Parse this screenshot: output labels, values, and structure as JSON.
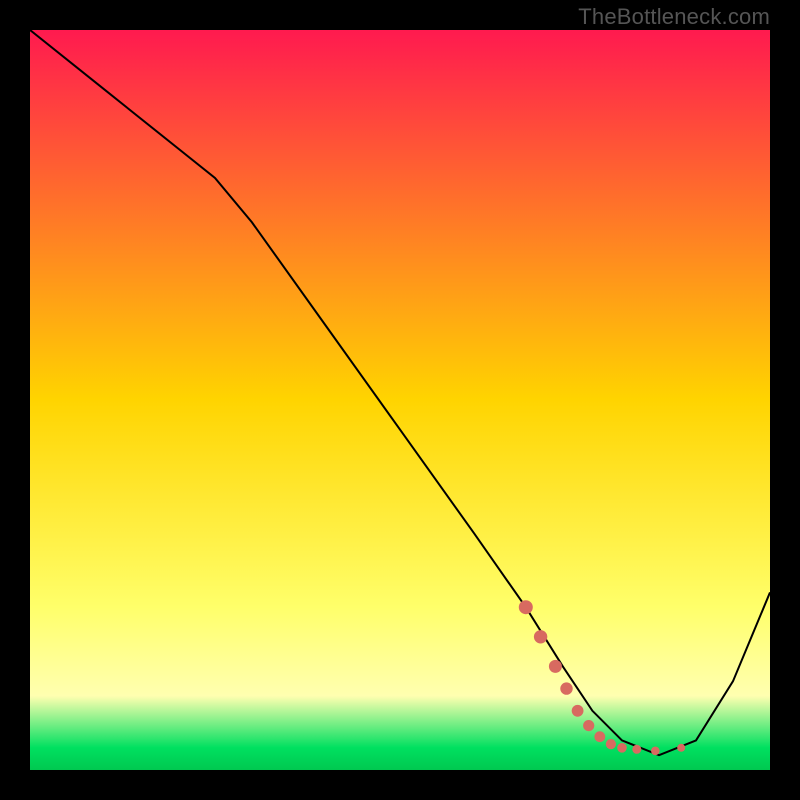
{
  "watermark": "TheBottleneck.com",
  "chart_data": {
    "type": "line",
    "title": "",
    "xlabel": "",
    "ylabel": "",
    "xlim": [
      0,
      100
    ],
    "ylim": [
      0,
      100
    ],
    "grid": false,
    "legend": false,
    "background_gradient": {
      "stops": [
        {
          "offset": 0.0,
          "color": "#ff1a4f"
        },
        {
          "offset": 0.5,
          "color": "#ffd400"
        },
        {
          "offset": 0.78,
          "color": "#ffff6a"
        },
        {
          "offset": 0.9,
          "color": "#ffffb0"
        },
        {
          "offset": 0.97,
          "color": "#00e060"
        },
        {
          "offset": 1.0,
          "color": "#00c850"
        }
      ]
    },
    "series": [
      {
        "name": "curve",
        "color": "#000000",
        "width": 2,
        "x": [
          0,
          10,
          20,
          25,
          30,
          40,
          50,
          60,
          67,
          72,
          76,
          80,
          85,
          90,
          95,
          100
        ],
        "y": [
          100,
          92,
          84,
          80,
          74,
          60,
          46,
          32,
          22,
          14,
          8,
          4,
          2,
          4,
          12,
          24
        ]
      }
    ],
    "markers": {
      "name": "highlight-dots",
      "color": "#d86a60",
      "radius_start": 7,
      "radius_end": 4,
      "points": [
        {
          "x": 67,
          "y": 22
        },
        {
          "x": 69,
          "y": 18
        },
        {
          "x": 71,
          "y": 14
        },
        {
          "x": 72.5,
          "y": 11
        },
        {
          "x": 74,
          "y": 8
        },
        {
          "x": 75.5,
          "y": 6
        },
        {
          "x": 77,
          "y": 4.5
        },
        {
          "x": 78.5,
          "y": 3.5
        },
        {
          "x": 80,
          "y": 3
        },
        {
          "x": 82,
          "y": 2.8
        },
        {
          "x": 84.5,
          "y": 2.6
        },
        {
          "x": 88,
          "y": 3.0
        }
      ]
    }
  }
}
